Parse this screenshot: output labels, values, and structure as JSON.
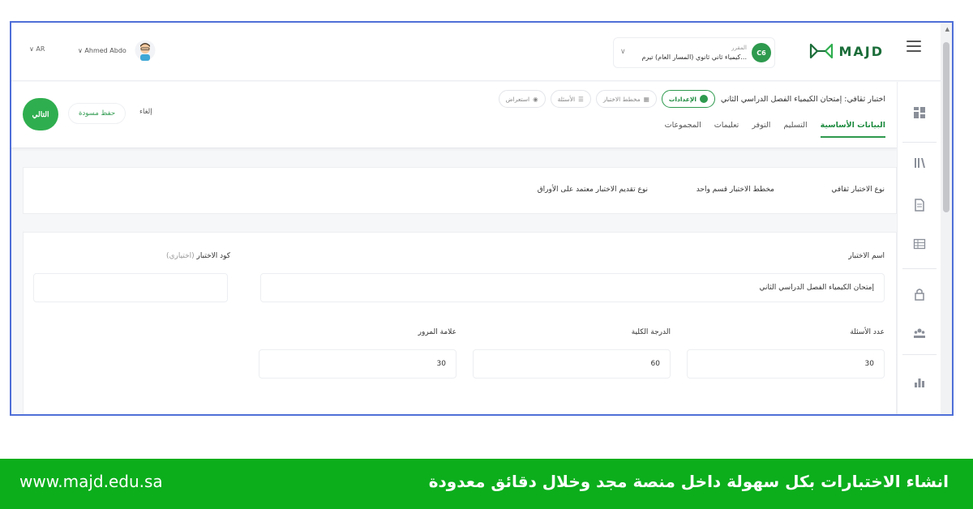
{
  "header": {
    "brand": "MAJD",
    "course_label": "المقرر",
    "course_name": "كيمياء ثاني ثانوي (المسار العام) تيرم...",
    "course_badge": "C6",
    "user_name": "Ahmed Abdo",
    "language": "AR"
  },
  "subheader": {
    "exam_title": "اختبار ثقافي: إمتحان الكيمياء الفصل الدراسي الثاني",
    "steps": [
      {
        "label": "الإعدادات",
        "active": true
      },
      {
        "label": "مخطط الاختبار",
        "active": false
      },
      {
        "label": "الأسئلة",
        "active": false
      },
      {
        "label": "استعراض",
        "active": false
      }
    ],
    "tabs": [
      {
        "label": "البيانات الأساسية",
        "active": true
      },
      {
        "label": "التسليم",
        "active": false
      },
      {
        "label": "التوفر",
        "active": false
      },
      {
        "label": "تعليمات",
        "active": false
      },
      {
        "label": "المجموعات",
        "active": false
      }
    ],
    "next_button": "التالي",
    "save_draft_button": "حفظ مسودة",
    "cancel_button": "إلغاء"
  },
  "info": {
    "exam_type": "نوع الاختبار ثقافي",
    "exam_plan": "مخطط الاختبار قسم واحد",
    "delivery_type": "نوع تقديم الاختبار معتمد على الأوراق"
  },
  "form": {
    "exam_name_label": "اسم الاختبار",
    "exam_name_value": "إمتحان الكيمياء الفصل الدراسي الثاني",
    "exam_code_label": "كود الاختبار",
    "exam_code_optional": "(اختياري)",
    "exam_code_value": "",
    "questions_count_label": "عدد الأسئلة",
    "questions_count_value": "30",
    "total_grade_label": "الدرجة الكلية",
    "total_grade_value": "60",
    "pass_mark_label": "علامة المرور",
    "pass_mark_value": "30"
  },
  "sidebar": {
    "icons": [
      "dashboard-icon",
      "library-icon",
      "document-icon",
      "table-icon",
      "lock-icon",
      "users-icon",
      "bar-chart-icon"
    ]
  },
  "banner": {
    "url": "www.majd.edu.sa",
    "title": "انشاء الاختبارات بكل سهولة داخل منصة مجد وخلال دقائق معدودة"
  },
  "colors": {
    "accent": "#2e9a4e",
    "banner": "#0cae1c",
    "frame_border": "#4f6fd8"
  }
}
